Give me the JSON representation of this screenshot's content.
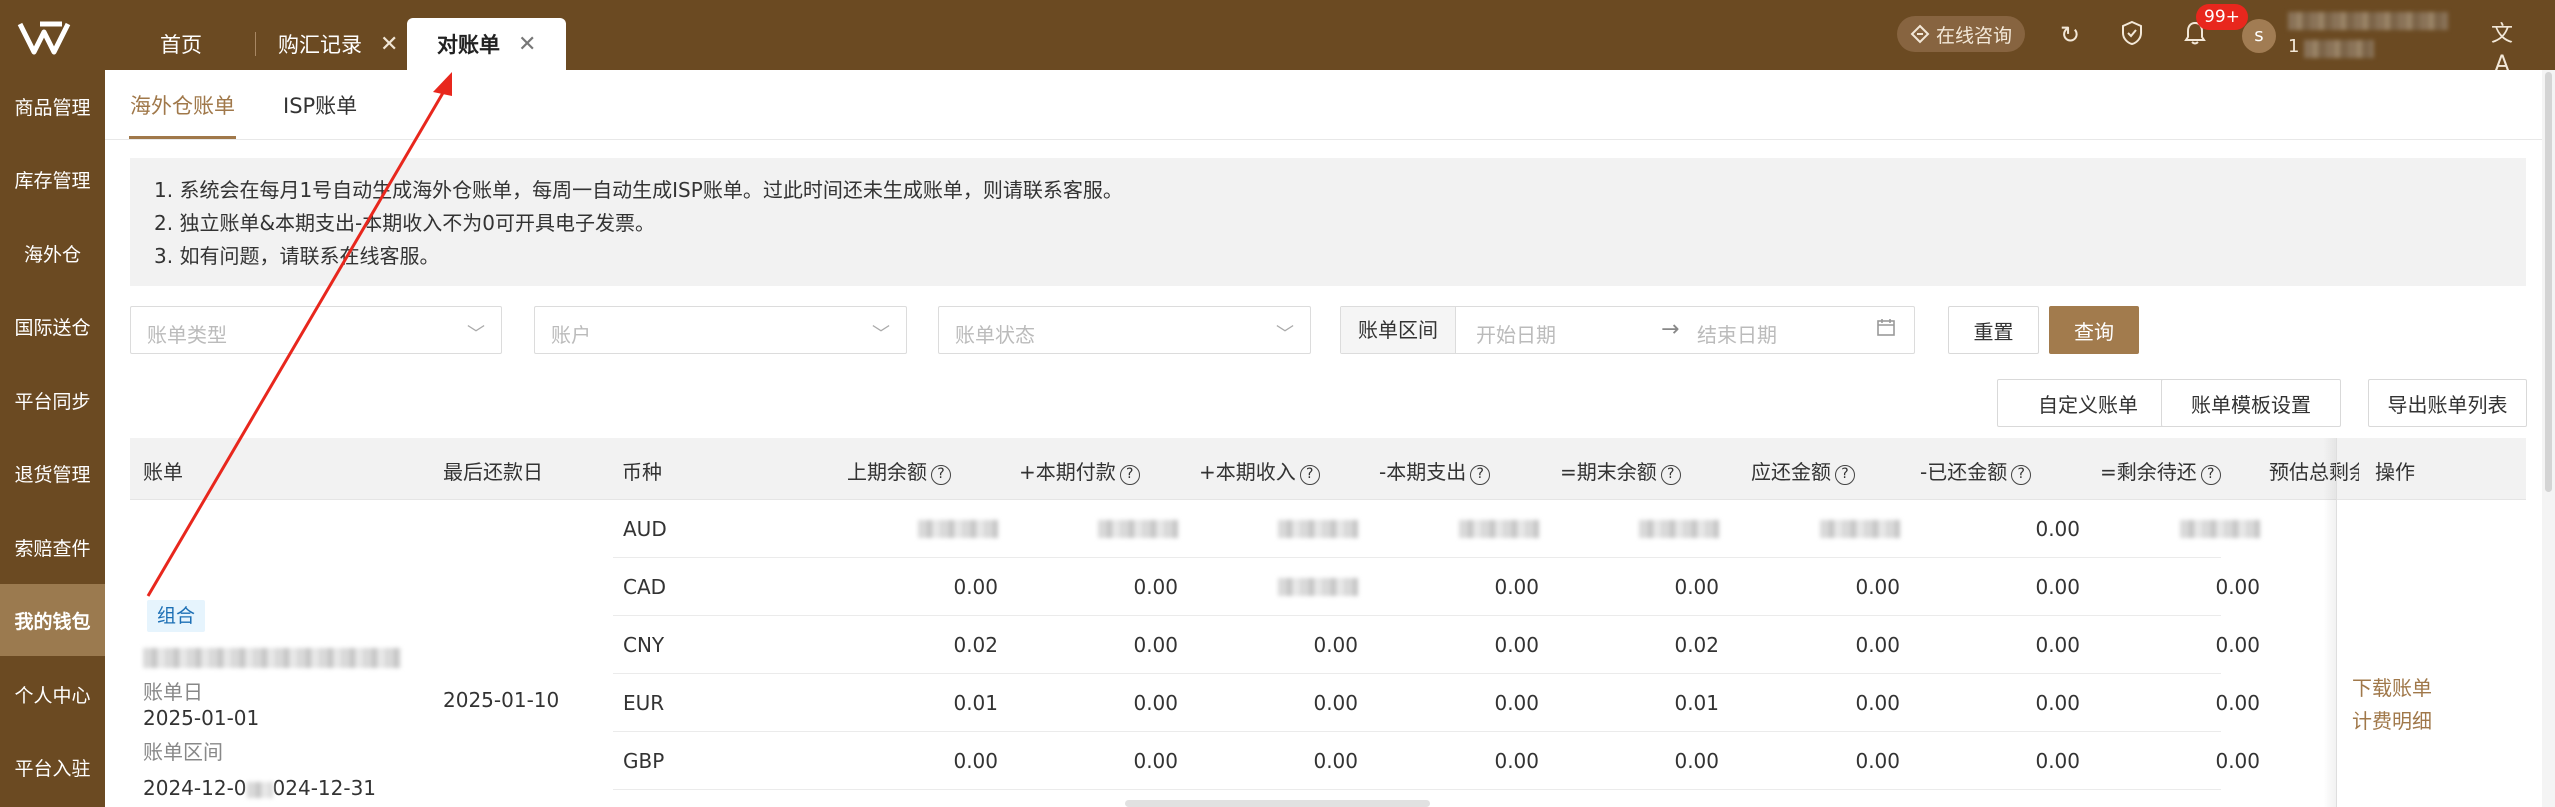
{
  "colors": {
    "brand": "#6b4a22",
    "accent": "#a0784a",
    "primary_button": "#a27b4d",
    "badge": "#e8271d",
    "annotation_arrow": "#e8271d"
  },
  "topbar": {
    "tabs": [
      {
        "label": "首页"
      },
      {
        "label": "购汇记录",
        "close_icon": "close-icon"
      },
      {
        "label": "对账单",
        "close_icon": "close-icon"
      }
    ],
    "consult_label": "在线咨询",
    "notification_badge": "99+",
    "avatar_letter": "s",
    "user_id_visible": "1",
    "icons": [
      "refresh-icon",
      "shield-icon",
      "bell-icon",
      "translate-icon"
    ]
  },
  "sidebar": {
    "items": [
      {
        "label": "商品管理"
      },
      {
        "label": "库存管理"
      },
      {
        "label": "海外仓"
      },
      {
        "label": "国际送仓"
      },
      {
        "label": "平台同步"
      },
      {
        "label": "退货管理"
      },
      {
        "label": "索赔查件"
      },
      {
        "label": "我的钱包",
        "active": true
      },
      {
        "label": "个人中心"
      },
      {
        "label": "平台入驻"
      }
    ]
  },
  "subtabs": [
    {
      "label": "海外仓账单",
      "active": true
    },
    {
      "label": "ISP账单"
    }
  ],
  "notice": {
    "lines": [
      "1. 系统会在每月1号自动生成海外仓账单，每周一自动生成ISP账单。过此时间还未生成账单，则请联系客服。",
      "2. 独立账单&本期支出-本期收入不为0可开具电子发票。",
      "3. 如有问题，请联系在线客服。"
    ]
  },
  "filters": {
    "bill_type_placeholder": "账单类型",
    "account_placeholder": "账户",
    "bill_status_placeholder": "账单状态",
    "range_label": "账单区间",
    "start_placeholder": "开始日期",
    "end_placeholder": "结束日期",
    "reset_label": "重置",
    "query_label": "查询"
  },
  "actions": {
    "custom_bill": "自定义账单",
    "template_settings": "账单模板设置",
    "export_list": "导出账单列表"
  },
  "table": {
    "headers": {
      "bill": "账单",
      "last_due": "最后还款日",
      "currency": "币种",
      "prev_balance": "上期余额",
      "payment": "+本期付款",
      "income": "+本期收入",
      "expense": "-本期支出",
      "end_balance": "=期末余额",
      "due_amount": "应还金额",
      "paid_amount": "-已还金额",
      "remaining": "=剩余待还",
      "est_remaining": "预估总剩余",
      "ops": "操作"
    },
    "group": {
      "tag": "组合",
      "bill_date_label": "账单日",
      "bill_date": "2025-01-01",
      "range_label": "账单区间",
      "range_visible": "2024-12-0",
      "range_visible_end": "024-12-31",
      "last_due_date": "2025-01-10"
    },
    "rows": [
      {
        "currency": "AUD",
        "prev": "",
        "pay": "",
        "inc": "",
        "exp": "",
        "end": "",
        "due": "",
        "paid": "0.00",
        "rem": ""
      },
      {
        "currency": "CAD",
        "prev": "0.00",
        "pay": "0.00",
        "inc": "",
        "exp": "0.00",
        "end": "0.00",
        "due": "0.00",
        "paid": "0.00",
        "rem": "0.00"
      },
      {
        "currency": "CNY",
        "prev": "0.02",
        "pay": "0.00",
        "inc": "0.00",
        "exp": "0.00",
        "end": "0.02",
        "due": "0.00",
        "paid": "0.00",
        "rem": "0.00"
      },
      {
        "currency": "EUR",
        "prev": "0.01",
        "pay": "0.00",
        "inc": "0.00",
        "exp": "0.00",
        "end": "0.01",
        "due": "0.00",
        "paid": "0.00",
        "rem": "0.00"
      },
      {
        "currency": "GBP",
        "prev": "0.00",
        "pay": "0.00",
        "inc": "0.00",
        "exp": "0.00",
        "end": "0.00",
        "due": "0.00",
        "paid": "0.00",
        "rem": "0.00"
      }
    ],
    "ops": {
      "download": "下载账单",
      "detail": "计费明细"
    }
  }
}
